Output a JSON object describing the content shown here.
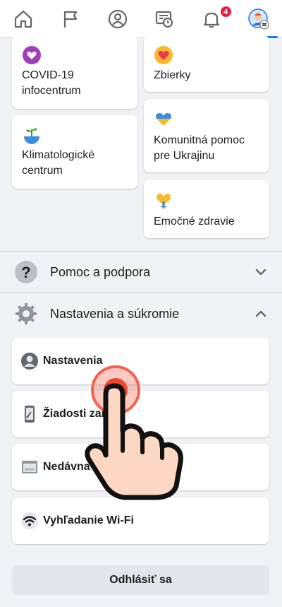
{
  "nav": {
    "notification_count": "4"
  },
  "grid": {
    "covid": "COVID-19 infocentrum",
    "zbierky": "Zbierky",
    "klima": "Klimatologické centrum",
    "ukrajina": "Komunitná pomoc pre Ukrajinu",
    "emocne": "Emočné zdravie"
  },
  "sections": {
    "help": "Pomoc a podpora",
    "settings": "Nastavenia a súkromie"
  },
  "settings_items": [
    {
      "label": "Nastavenia",
      "icon": "person-circle-icon"
    },
    {
      "label": "Žiadosti zar",
      "icon": "phone-icon"
    },
    {
      "label": "Nedávna re",
      "icon": "browser-icon"
    },
    {
      "label": "Vyhľadanie Wi-Fi",
      "icon": "wifi-icon"
    }
  ],
  "logout": "Odhlásiť sa",
  "colors": {
    "accent": "#1877f2",
    "badge": "#e41e3f",
    "tap": "#f0462c"
  }
}
